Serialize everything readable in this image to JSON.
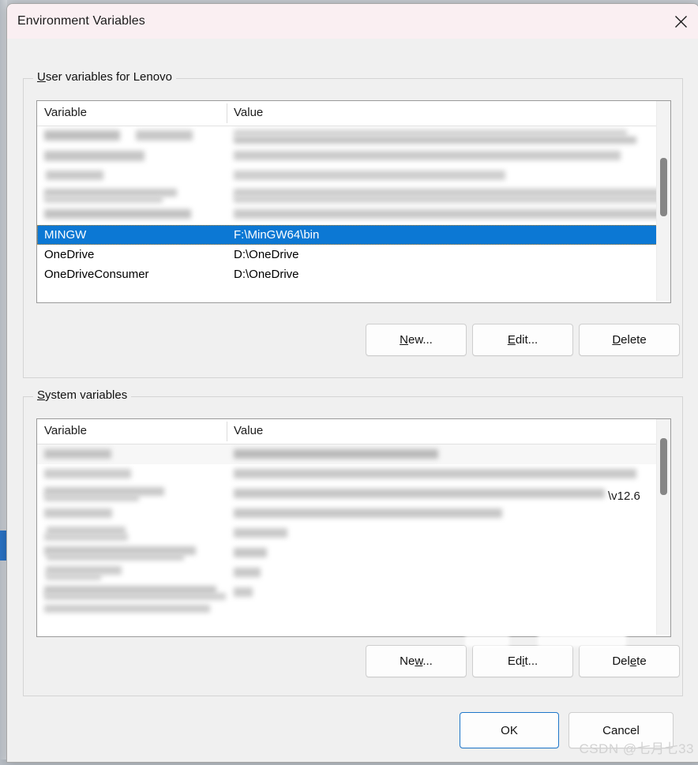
{
  "window": {
    "title": "Environment Variables",
    "close_icon": "close-icon",
    "titlebar_color": "#faeff2",
    "body_color": "#f0f0f0"
  },
  "user_section": {
    "legend_accel": "U",
    "legend_rest": "ser variables for Lenovo",
    "legend_full": "User variables for Lenovo",
    "columns": [
      "Variable",
      "Value"
    ],
    "rows": [
      {
        "variable": "",
        "value": "",
        "redacted": true,
        "selected": false
      },
      {
        "variable": "",
        "value": "",
        "redacted": true,
        "selected": false
      },
      {
        "variable": "",
        "value": "",
        "redacted": true,
        "selected": false
      },
      {
        "variable": "",
        "value": "",
        "redacted": true,
        "selected": false
      },
      {
        "variable": "",
        "value": "",
        "redacted": true,
        "selected": false
      },
      {
        "variable": "MINGW",
        "value": "F:\\MinGW64\\bin",
        "redacted": false,
        "selected": true
      },
      {
        "variable": "OneDrive",
        "value": "D:\\OneDrive",
        "redacted": false,
        "selected": false
      },
      {
        "variable": "OneDriveConsumer",
        "value": "D:\\OneDrive",
        "redacted": false,
        "selected": false
      }
    ],
    "buttons": [
      {
        "accel": "N",
        "rest": "ew...",
        "full": "New..."
      },
      {
        "accel": "E",
        "rest": "dit...",
        "full": "Edit..."
      },
      {
        "accel": "D",
        "rest": "elete",
        "full": "Delete"
      }
    ]
  },
  "system_section": {
    "legend_accel": "S",
    "legend_rest": "ystem variables",
    "legend_full": "System variables",
    "columns": [
      "Variable",
      "Value"
    ],
    "visible_value_fragment": "\\v12.6",
    "rows": [
      {
        "variable": "",
        "value": "",
        "redacted": true
      },
      {
        "variable": "",
        "value": "",
        "redacted": true
      },
      {
        "variable": "",
        "value": "",
        "redacted": true
      },
      {
        "variable": "",
        "value": "",
        "redacted": true
      },
      {
        "variable": "",
        "value": "",
        "redacted": true
      },
      {
        "variable": "",
        "value": "",
        "redacted": true
      },
      {
        "variable": "",
        "value": "",
        "redacted": true
      },
      {
        "variable": "",
        "value": "",
        "redacted": true
      },
      {
        "variable": "",
        "value": "",
        "redacted": true
      }
    ],
    "buttons": [
      {
        "accel": "w",
        "pre": "Ne",
        "rest": "...",
        "full": "New..."
      },
      {
        "accel": "i",
        "pre": "Ed",
        "rest": "t...",
        "full": "Edit..."
      },
      {
        "accel": "e",
        "pre": "Del",
        "rest": "te",
        "full": "Delete"
      }
    ]
  },
  "footer": {
    "ok_label": "OK",
    "cancel_label": "Cancel",
    "default_button": "OK",
    "accent_color": "#1d76c9"
  },
  "watermark": {
    "text": "CSDN @七月七33"
  }
}
